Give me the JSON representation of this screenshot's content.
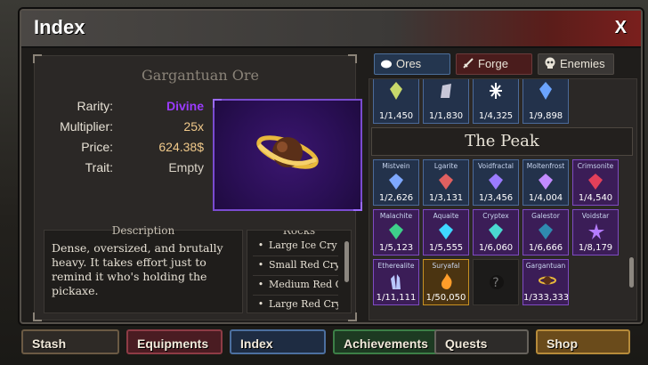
{
  "window": {
    "title": "Index",
    "close_label": "X"
  },
  "item": {
    "name": "Gargantuan Ore",
    "stats": [
      {
        "label": "Rarity:",
        "value": "Divine"
      },
      {
        "label": "Multiplier:",
        "value": "25x"
      },
      {
        "label": "Price:",
        "value": "624.38$"
      },
      {
        "label": "Trait:",
        "value": "Empty"
      }
    ],
    "description_title": "Description",
    "description": "Dense, oversized, and brutally heavy. It takes effort just to remind it who's holding the pickaxe.",
    "rocks_title": "Rocks",
    "rocks": [
      "Large Ice Cry",
      "Small Red Cry",
      "Medium Red Cry",
      "Large Red Cry"
    ]
  },
  "tabs": [
    {
      "label": "Ores",
      "icon": "pebble-icon"
    },
    {
      "label": "Forge",
      "icon": "sword-icon"
    },
    {
      "label": "Enemies",
      "icon": "skull-icon"
    }
  ],
  "grid": {
    "top_row": [
      {
        "count": "1/1,450"
      },
      {
        "count": "1/1,830"
      },
      {
        "count": "1/4,325"
      },
      {
        "count": "1/9,898"
      }
    ],
    "section_title": "The Peak",
    "ores": [
      {
        "name": "Mistvein",
        "count": "1/2,626",
        "tier": "blue"
      },
      {
        "name": "Lgarite",
        "count": "1/3,131",
        "tier": "blue"
      },
      {
        "name": "Voidfractal",
        "count": "1/3,456",
        "tier": "blue"
      },
      {
        "name": "Moltenfrost",
        "count": "1/4,004",
        "tier": "blue"
      },
      {
        "name": "Crimsonite",
        "count": "1/4,540",
        "tier": "purple"
      },
      {
        "name": "Malachite",
        "count": "1/5,123",
        "tier": "purple"
      },
      {
        "name": "Aquaite",
        "count": "1/5,555",
        "tier": "purple"
      },
      {
        "name": "Cryptex",
        "count": "1/6,060",
        "tier": "purple"
      },
      {
        "name": "Galestor",
        "count": "1/6,666",
        "tier": "purple"
      },
      {
        "name": "Voidstar",
        "count": "1/8,179",
        "tier": "purple"
      },
      {
        "name": "Etherealite",
        "count": "1/11,111",
        "tier": "gold"
      },
      {
        "name": "Suryafal",
        "count": "1/50,050",
        "tier": "gold"
      },
      {
        "name": "",
        "count": "?",
        "tier": "dark"
      },
      {
        "name": "Gargantuan",
        "count": "1/333,333",
        "tier": "purple"
      }
    ]
  },
  "nav": {
    "stash": "Stash",
    "equipments": "Equipments",
    "index": "Index",
    "achievements": "Achievements",
    "quests": "Quests",
    "shop": "Shop"
  },
  "colors": {
    "divine": "#9b3bff",
    "gold_text": "#f0c98a",
    "panel_bg": "#1f1d1b"
  }
}
